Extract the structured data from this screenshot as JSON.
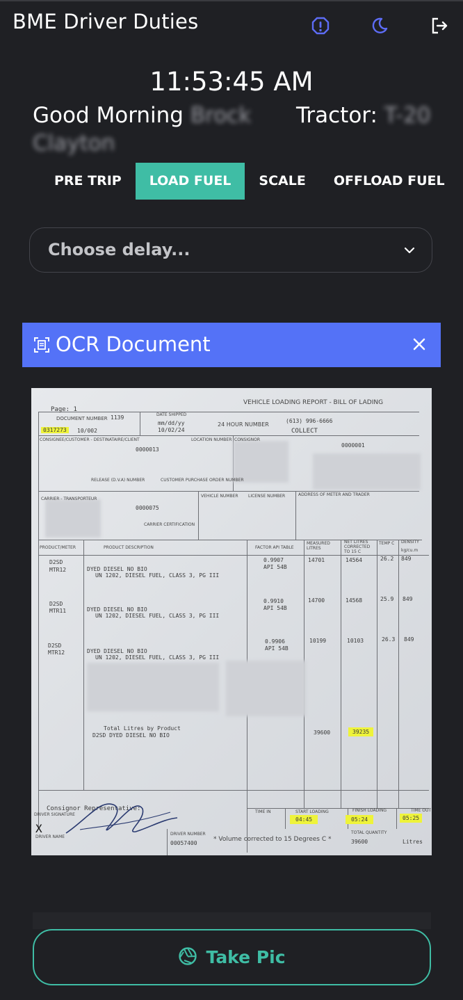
{
  "header": {
    "title": "BME Driver Duties",
    "icons": [
      "alert-icon",
      "moon-icon",
      "logout-icon"
    ]
  },
  "clock": "11:53:45 AM",
  "greeting": {
    "prefix": "Good Morning",
    "first_name": "Brock",
    "last_name": "Clayton",
    "tractor_label": "Tractor:",
    "tractor_value": "T-20"
  },
  "tabs": [
    {
      "label": "PRE TRIP",
      "active": false
    },
    {
      "label": "LOAD FUEL",
      "active": true
    },
    {
      "label": "SCALE",
      "active": false
    },
    {
      "label": "OFFLOAD FUEL",
      "active": false
    }
  ],
  "delay_select": {
    "placeholder": "Choose delay..."
  },
  "ocr_panel": {
    "title": "OCR Document"
  },
  "document": {
    "page": "Page: 1",
    "report_title": "VEHICLE LOADING REPORT - BILL OF LADING",
    "document_number_label": "DOCUMENT NUMBER",
    "document_number": "1139",
    "doc_id": "0317273",
    "doc_code": "10/002",
    "date_shipped_label": "DATE SHIPPED",
    "date_format": "mm/dd/yy",
    "date": "10/02/24",
    "hour_label": "24 HOUR NUMBER",
    "hour_number": "(613) 996-6666",
    "collect": "COLLECT",
    "location_label": "LOCATION NUMBER",
    "consignor_label": "CONSIGNOR",
    "consignee_label": "CONSIGNEE/CUSTOMER - DESTINATAIRE/CLIENT",
    "consignee_no": "0000013",
    "consignor_no": "0000001",
    "release_label": "RELEASE (D.V.A) NUMBER",
    "po_label": "CUSTOMER PURCHASE ORDER NUMBER",
    "carrier_label": "CARRIER - TRANSPORTEUR",
    "carrier_no": "0000075",
    "vehicle_label": "VEHICLE NUMBER",
    "license_label": "LICENSE NUMBER",
    "address_label": "ADDRESS OF METER AND TRADER",
    "carrier_cert_label": "CARRIER CERTIFICATION",
    "col_meter": "PRODUCT/METER",
    "col_desc": "PRODUCT DESCRIPTION",
    "col_factor": "FACTOR API TABLE",
    "col_measured": "MEASURED LITRES",
    "col_net": "NET LITRES CORRECTED TO 15 C",
    "col_temp": "TEMP C",
    "col_density": "DENSITY",
    "density_unit": "kg/cu.m",
    "rows": [
      {
        "code": "D2SD",
        "meter": "MTR12",
        "desc1": "DYED DIESEL NO BIO",
        "desc2": "UN 1202, DIESEL FUEL, CLASS 3, PG III",
        "factor": "0.9907",
        "api": "API 54B",
        "measured": "14701",
        "net": "14564",
        "temp": "26.2",
        "density": "849"
      },
      {
        "code": "D2SD",
        "meter": "MTR11",
        "desc1": "DYED DIESEL NO BIO",
        "desc2": "UN 1202, DIESEL FUEL, CLASS 3, PG III",
        "factor": "0.9910",
        "api": "API 54B",
        "measured": "14700",
        "net": "14568",
        "temp": "25.9",
        "density": "849"
      },
      {
        "code": "D2SD",
        "meter": "MTR12",
        "desc1": "DYED DIESEL NO BIO",
        "desc2": "UN 1202, DIESEL FUEL, CLASS 3, PG III",
        "factor": "0.9906",
        "api": "API 54B",
        "measured": "10199",
        "net": "10103",
        "temp": "26.3",
        "density": "849"
      }
    ],
    "total_label": "Total Litres by Product",
    "total_product": "D2SD    DYED DIESEL NO BIO",
    "total_measured": "39600",
    "total_net": "39235",
    "consignor_rep": "Consignor Representative:",
    "driver_signature": "DRIVER SIGNATURE",
    "x_mark": "X",
    "driver_name": "DRIVER NAME",
    "driver_number_label": "DRIVER NUMBER",
    "driver_number": "00057400",
    "volume_note": "* Volume corrected to 15 Degrees C *",
    "time_in_label": "TIME IN",
    "start_loading_label": "START LOADING",
    "start_loading": "04:45",
    "finish_loading_label": "FINISH LOADING",
    "finish_loading": "05:24",
    "time_out_label": "TIME OUT",
    "time_out": "05:25",
    "total_qty_label": "TOTAL QUANTITY",
    "total_qty": "39600",
    "total_unit": "Litres"
  },
  "actions": {
    "take_pic": "Take Pic"
  },
  "colors": {
    "background": "#1f2024",
    "accent_teal": "#3fbda5",
    "ocr_bar": "#5472f7",
    "icon_blue": "#5d6cf6"
  }
}
